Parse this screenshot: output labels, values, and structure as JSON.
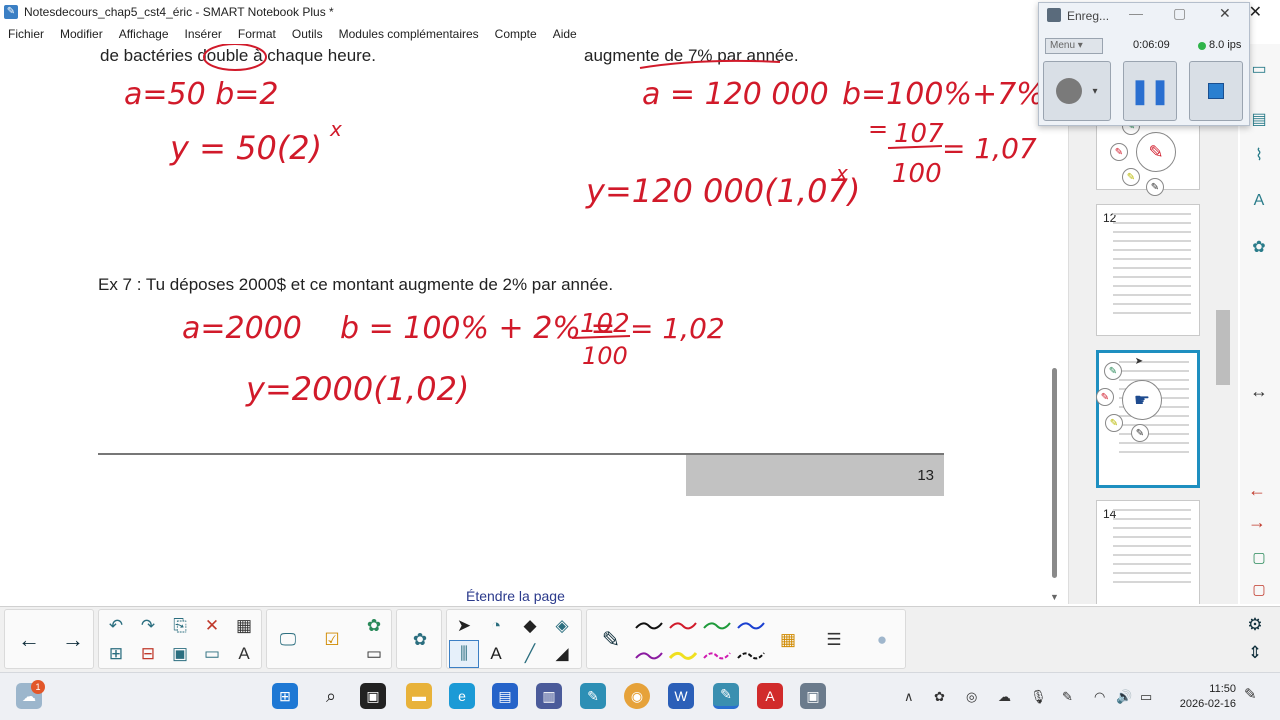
{
  "window": {
    "title": "Notesdecours_chap5_cst4_éric - SMART Notebook Plus *",
    "close_label": "✕"
  },
  "menu": [
    "Fichier",
    "Modifier",
    "Affichage",
    "Insérer",
    "Format",
    "Outils",
    "Modules complémentaires",
    "Compte",
    "Aide"
  ],
  "page": {
    "line_left_top": "de bactéries double à chaque heure.",
    "line_right_top": "augmente de 7% par année.",
    "ex7": "Ex 7 : Tu déposes 2000$ et ce montant augmente de 2% par année.",
    "page_number": "13",
    "extend_page": "Étendre la page"
  },
  "handwriting": {
    "left_a_b": "a=50   b=2",
    "left_formula": "y = 50(2)",
    "left_exp": "x",
    "right_a": "a = 120 000",
    "right_b": "b=100%+7%",
    "right_frac_eq": "=",
    "right_frac_num": "107",
    "right_frac_den": "100",
    "right_frac_result": "= 1,07",
    "right_formula": "y=120 000(1,07)",
    "right_exp": "x",
    "ex7_a": "a=2000",
    "ex7_b": "b = 100% + 2% =",
    "ex7_frac_num": "102",
    "ex7_frac_den": "100",
    "ex7_frac_result": "= 1,02",
    "ex7_formula": "y=2000(1,02)"
  },
  "sorter": {
    "thumbs": [
      {
        "num": "12",
        "active": false
      },
      {
        "num": "",
        "active": true
      },
      {
        "num": "14",
        "active": false
      }
    ]
  },
  "recorder": {
    "title": "Enreg...",
    "menu_label": "Menu",
    "time": "0:06:09",
    "fps": "8.0 ips",
    "status_color": "#2fb44a"
  },
  "taskbar": {
    "weather_badge": "1",
    "time": "11:50",
    "date": "2026-02-16"
  },
  "colors": {
    "ink": "#d11a2a",
    "active_thumb": "#1e8fc0",
    "toolbar_icon": "#2b6e7f"
  }
}
